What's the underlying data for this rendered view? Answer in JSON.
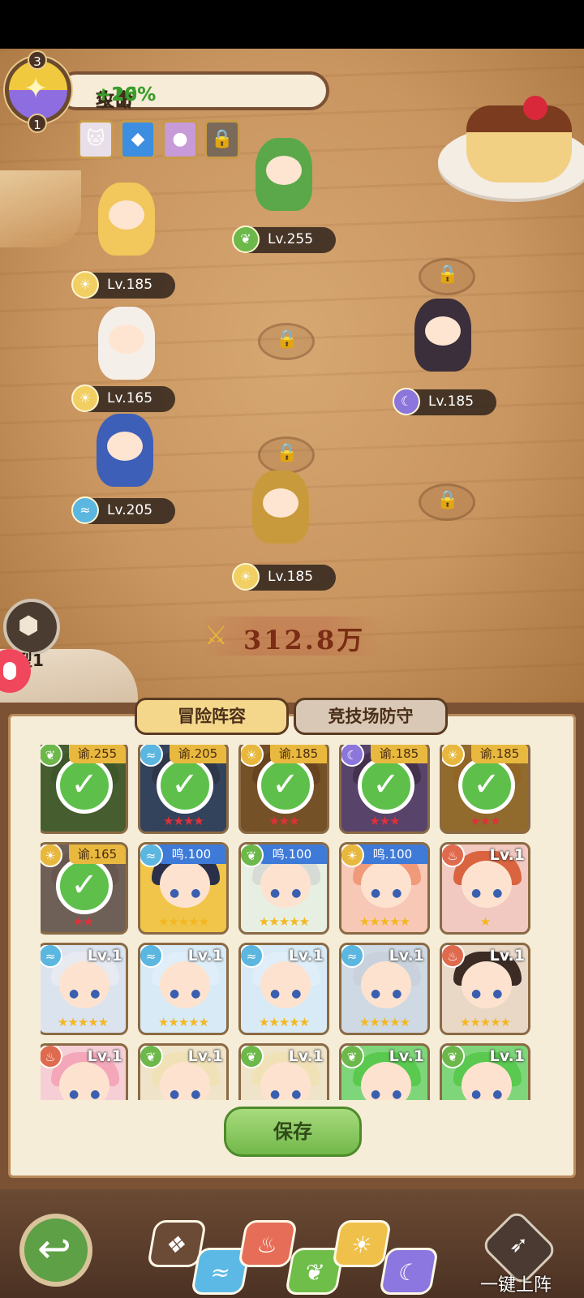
{
  "buff": {
    "prefix_atk": "攻击",
    "atk_value": "+16%",
    "prefix_hp": "生命",
    "hp_value": "+20%",
    "orb_top_number": "3",
    "orb_bottom_number": "1"
  },
  "board": {
    "heroes": [
      {
        "name": "forest-swordsman",
        "level": "Lv.255",
        "element": "nature-icon"
      },
      {
        "name": "priestess",
        "level": "Lv.185",
        "element": "light-icon"
      },
      {
        "name": "fox-king",
        "level": "Lv.165",
        "element": "light-icon"
      },
      {
        "name": "jester",
        "level": "Lv.185",
        "element": "moon-icon"
      },
      {
        "name": "witch",
        "level": "Lv.205",
        "element": "water-icon"
      },
      {
        "name": "golden-warrior",
        "level": "Lv.185",
        "element": "light-icon"
      }
    ],
    "power_value": "312.8万",
    "formation_label": "阵型1"
  },
  "tabs": {
    "adventure": "冒险阵容",
    "arena": "竞技场防守"
  },
  "roster": [
    {
      "tag": "谕.255",
      "tagtype": "yu",
      "element": "nature",
      "selected": true,
      "stars": "",
      "stars2": "★★★★",
      "color": "#4f8a3c"
    },
    {
      "tag": "谕.205",
      "tagtype": "yu",
      "element": "water",
      "selected": true,
      "stars": "★★★★",
      "color": "#2f5a8e"
    },
    {
      "tag": "谕.185",
      "tagtype": "yu",
      "element": "light",
      "selected": true,
      "stars": "★★★",
      "color": "#a5742f"
    },
    {
      "tag": "谕.185",
      "tagtype": "yu",
      "element": "moon",
      "selected": true,
      "stars": "★★★",
      "color": "#6f5aa8"
    },
    {
      "tag": "谕.185",
      "tagtype": "yu",
      "element": "light",
      "selected": true,
      "stars": "★★★",
      "color": "#d8a23a"
    },
    {
      "tag": "谕.165",
      "tagtype": "yu",
      "element": "light",
      "selected": true,
      "stars": "★★",
      "color": "#9a8e86"
    },
    {
      "tag": "鸣.100",
      "tagtype": "ming",
      "element": "water",
      "selected": false,
      "stars": "★★★★★",
      "color": "#f0c54a"
    },
    {
      "tag": "鸣.100",
      "tagtype": "ming",
      "element": "nature",
      "selected": false,
      "stars": "★★★★★",
      "color": "#e6efe2"
    },
    {
      "tag": "鸣.100",
      "tagtype": "ming",
      "element": "light",
      "selected": false,
      "stars": "★★★★★",
      "color": "#f8c8b6"
    },
    {
      "tag": "Lv.1",
      "tagtype": "lv",
      "element": "fire",
      "selected": false,
      "stars": "★",
      "color": "#f2c9c0"
    },
    {
      "tag": "Lv.1",
      "tagtype": "lv",
      "element": "water",
      "selected": false,
      "stars": "★★★★★",
      "color": "#dbe3ef"
    },
    {
      "tag": "Lv.1",
      "tagtype": "lv",
      "element": "water",
      "selected": false,
      "stars": "★★★★★",
      "color": "#d8eaf5"
    },
    {
      "tag": "Lv.1",
      "tagtype": "lv",
      "element": "water",
      "selected": false,
      "stars": "★★★★★",
      "color": "#d8eaf5"
    },
    {
      "tag": "Lv.1",
      "tagtype": "lv",
      "element": "water",
      "selected": false,
      "stars": "★★★★★",
      "color": "#cfd9e3"
    },
    {
      "tag": "Lv.1",
      "tagtype": "lv",
      "element": "fire",
      "selected": false,
      "stars": "★★★★★",
      "color": "#e9d8c6"
    },
    {
      "tag": "Lv.1",
      "tagtype": "lv",
      "element": "fire",
      "selected": false,
      "stars": "",
      "color": "#f6cfd6"
    },
    {
      "tag": "Lv.1",
      "tagtype": "lv",
      "element": "nature",
      "selected": false,
      "stars": "",
      "color": "#efe4c9"
    },
    {
      "tag": "Lv.1",
      "tagtype": "lv",
      "element": "nature",
      "selected": false,
      "stars": "",
      "color": "#efe4c9"
    },
    {
      "tag": "Lv.1",
      "tagtype": "lv",
      "element": "nature",
      "selected": false,
      "stars": "",
      "color": "#7fd67a"
    },
    {
      "tag": "Lv.1",
      "tagtype": "lv",
      "element": "nature",
      "selected": false,
      "stars": "",
      "color": "#7fd67a"
    }
  ],
  "buttons": {
    "save": "保存",
    "quick_deploy": "一键上阵"
  },
  "filters": [
    "all-icon",
    "water-icon",
    "fire-icon",
    "nature-icon",
    "light-icon",
    "moon-icon"
  ]
}
